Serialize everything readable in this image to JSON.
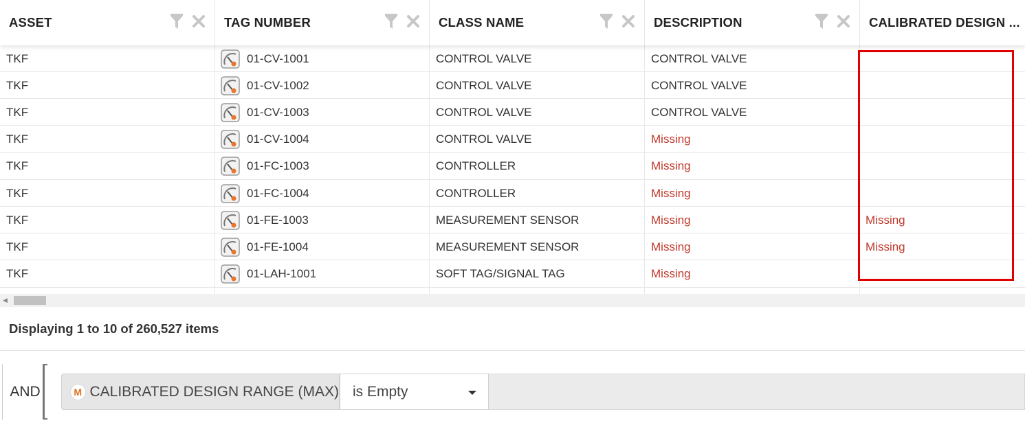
{
  "grid": {
    "columns": [
      {
        "label": "ASSET"
      },
      {
        "label": "TAG NUMBER"
      },
      {
        "label": "CLASS NAME"
      },
      {
        "label": "DESCRIPTION"
      },
      {
        "label": "CALIBRATED DESIGN ..."
      }
    ],
    "rows": [
      {
        "asset": "TKF",
        "tag": "01-CV-1001",
        "class_name": "CONTROL VALVE",
        "description": "CONTROL VALVE",
        "calibrated": ""
      },
      {
        "asset": "TKF",
        "tag": "01-CV-1002",
        "class_name": "CONTROL VALVE",
        "description": "CONTROL VALVE",
        "calibrated": ""
      },
      {
        "asset": "TKF",
        "tag": "01-CV-1003",
        "class_name": "CONTROL VALVE",
        "description": "CONTROL VALVE",
        "calibrated": ""
      },
      {
        "asset": "TKF",
        "tag": "01-CV-1004",
        "class_name": "CONTROL VALVE",
        "description": "Missing",
        "calibrated": ""
      },
      {
        "asset": "TKF",
        "tag": "01-FC-1003",
        "class_name": "CONTROLLER",
        "description": "Missing",
        "calibrated": ""
      },
      {
        "asset": "TKF",
        "tag": "01-FC-1004",
        "class_name": "CONTROLLER",
        "description": "Missing",
        "calibrated": ""
      },
      {
        "asset": "TKF",
        "tag": "01-FE-1003",
        "class_name": "MEASUREMENT SENSOR",
        "description": "Missing",
        "calibrated": "Missing"
      },
      {
        "asset": "TKF",
        "tag": "01-FE-1004",
        "class_name": "MEASUREMENT SENSOR",
        "description": "Missing",
        "calibrated": "Missing"
      },
      {
        "asset": "TKF",
        "tag": "01-LAH-1001",
        "class_name": "SOFT TAG/SIGNAL TAG",
        "description": "Missing",
        "calibrated": ""
      }
    ],
    "missing_color": "#c0392b",
    "highlight_color": "#e00000"
  },
  "footer": {
    "status": "Displaying 1 to 10 of 260,527 items"
  },
  "filter": {
    "operator": "AND",
    "field_icon_letter": "M",
    "field": "CALIBRATED DESIGN RANGE (MAX)",
    "condition": "is Empty"
  }
}
